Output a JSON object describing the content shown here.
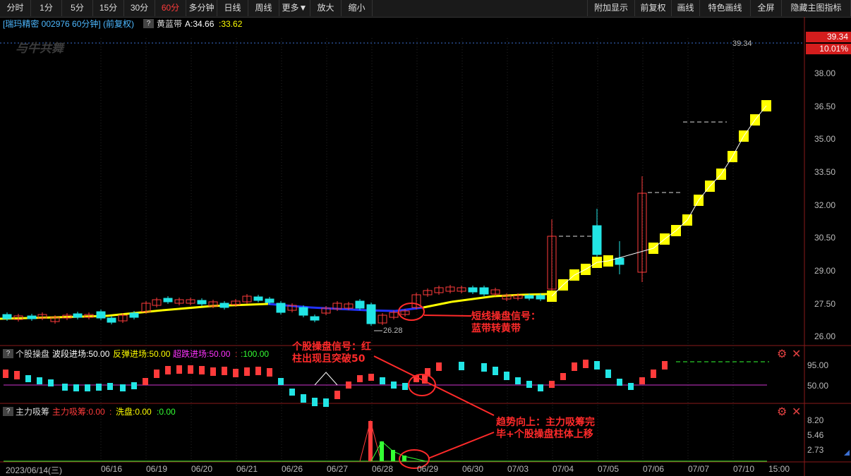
{
  "toolbar": {
    "left": [
      "分时",
      "1分",
      "5分",
      "15分",
      "30分",
      "60分",
      "多分钟",
      "日线",
      "周线",
      "更多▼",
      "放大",
      "缩小"
    ],
    "active": "60分",
    "right": [
      "附加显示",
      "前复权",
      "画线",
      "特色画线",
      "全屏",
      "隐藏主图指标"
    ]
  },
  "header": {
    "stock": "[瑞玛精密 002976 60分钟] (前复权)",
    "q": "?",
    "indicator": "黄蓝带",
    "a_label": "A:34.66",
    "b_value": ":33.62"
  },
  "watermark": "与牛共舞",
  "price_axis": {
    "top_value": "39.34",
    "top_pct": "10.01%",
    "ticks": [
      "38.00",
      "36.50",
      "35.00",
      "33.50",
      "32.00",
      "30.50",
      "29.00",
      "27.50",
      "26.00"
    ]
  },
  "price_labels": {
    "high_marker": "39.34",
    "low_marker": "26.28"
  },
  "panel1": {
    "title": "个股操盘",
    "items": [
      {
        "text": "波段进场:50.00",
        "color": "#ffffff"
      },
      {
        "text": "反弹进场:50.00",
        "color": "#ffff00"
      },
      {
        "text": "超跌进场:50.00",
        "color": "#ff33ff"
      },
      {
        "text": ":",
        "color": "#ff3b3b"
      },
      {
        "text": ":100.00",
        "color": "#33ff33"
      }
    ],
    "ticks": [
      "95.00",
      "50.00"
    ]
  },
  "panel2": {
    "title": "主力吸筹",
    "items": [
      {
        "text": "主力吸筹:0.00",
        "color": "#ff3b3b"
      },
      {
        "text": ":",
        "color": "#ff3b3b"
      },
      {
        "text": "洗盘:0.00",
        "color": "#ffff00"
      },
      {
        "text": ":0.00",
        "color": "#33ff33"
      }
    ],
    "ticks": [
      "8.20",
      "5.46",
      "2.73"
    ]
  },
  "dates": [
    "2023/06/14(三)",
    "06/16",
    "06/19",
    "06/20",
    "06/21",
    "06/26",
    "06/27",
    "06/28",
    "06/29",
    "06/30",
    "07/03",
    "07/04",
    "07/05",
    "07/06",
    "07/07",
    "07/10",
    "15:00"
  ],
  "annotations": {
    "a1": [
      "短线操盘信号：",
      "蓝带转黄带"
    ],
    "a2": [
      "个股操盘信号：红",
      "柱出现且突破50"
    ],
    "a3": [
      "趋势向上：主力吸筹完",
      "毕+个股操盘柱体上移"
    ]
  },
  "colors": {
    "up": "#ff3b3b",
    "down": "#22e5e5",
    "yellow_band": "#ffff00",
    "blue_band": "#2233ff",
    "annotation": "#ff2a2a"
  }
}
